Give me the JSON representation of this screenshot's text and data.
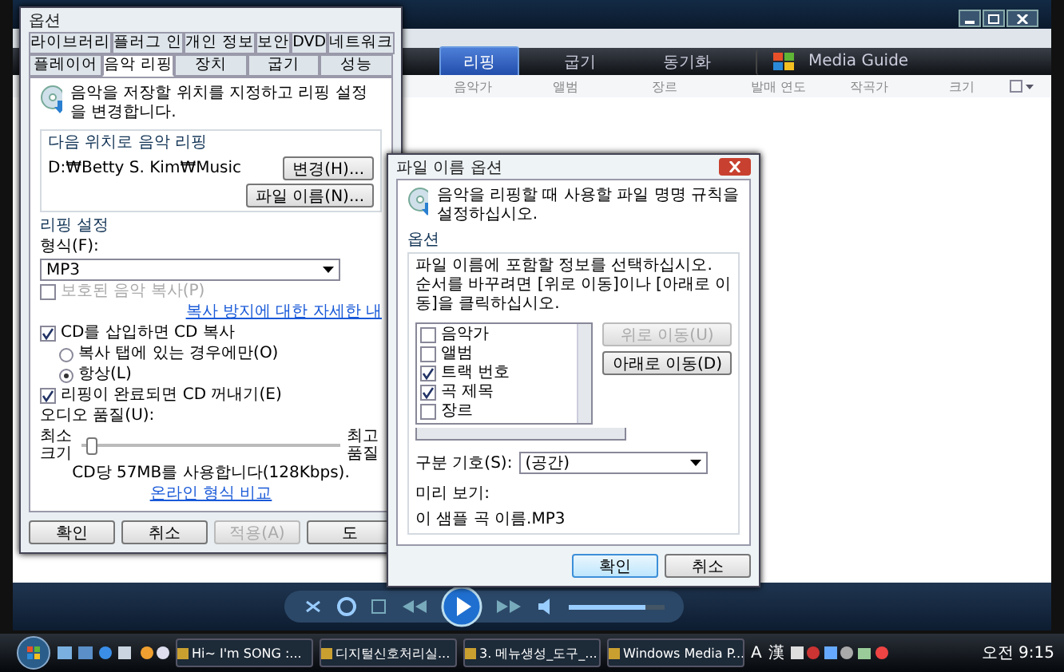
{
  "player": {
    "nav_tabs": [
      {
        "label": "리핑",
        "selected": true,
        "kind": "tab"
      },
      {
        "label": "굽기",
        "selected": false,
        "kind": "tab"
      },
      {
        "label": "동기화",
        "selected": false,
        "kind": "tab"
      },
      {
        "label": "Media Guide",
        "selected": false,
        "kind": "guide"
      }
    ],
    "columns": [
      "음악가",
      "앨범",
      "장르",
      "발매 연도",
      "작곡가",
      "크기"
    ],
    "volume": {
      "level": 0.8
    }
  },
  "options_dialog": {
    "title": "옵션",
    "tab_rows": [
      {
        "tabs": [
          {
            "label": "라이브러리",
            "selected": false
          },
          {
            "label": "플러그 인",
            "selected": false
          },
          {
            "label": "개인 정보",
            "selected": false
          },
          {
            "label": "보안",
            "selected": false
          },
          {
            "label": "DVD",
            "selected": false
          },
          {
            "label": "네트워크",
            "selected": false
          }
        ]
      },
      {
        "tabs": [
          {
            "label": "플레이어",
            "selected": false
          },
          {
            "label": "음악 리핑",
            "selected": true
          },
          {
            "label": "장치",
            "selected": false
          },
          {
            "label": "굽기",
            "selected": false
          },
          {
            "label": "성능",
            "selected": false
          }
        ]
      }
    ],
    "intro": "음악을 저장할 위치를 지정하고 리핑 설정을 변경합니다.",
    "location": {
      "label": "다음 위치로 음악 리핑",
      "path": "D:₩Betty S. Kim₩Music",
      "change_button": "변경(H)...",
      "filename_button": "파일 이름(N)..."
    },
    "settings_label": "리핑 설정",
    "format_label": "형식(F):",
    "format_value": "MP3",
    "items": [
      {
        "kind": "checkbox",
        "label": "보호된 음악 복사(P)",
        "checked": false,
        "disabled": true
      },
      {
        "kind": "link",
        "label": "복사 방지에 대한 자세한 내"
      },
      {
        "kind": "checkbox",
        "label": "CD를 삽입하면 CD 복사",
        "checked": true,
        "disabled": false
      },
      {
        "kind": "radio",
        "label": "복사 탭에 있는 경우에만(O)",
        "selected": false
      },
      {
        "kind": "radio",
        "label": "항상(L)",
        "selected": true
      },
      {
        "kind": "checkbox",
        "label": "리핑이 완료되면 CD 꺼내기(E)",
        "checked": true,
        "disabled": false
      }
    ],
    "quality": {
      "label": "오디오 품질(U):",
      "min_label": "최소 크기",
      "max_label": "최고 품질",
      "level": 0.02,
      "reading": "CD당 57MB를 사용합니다(128Kbps).",
      "link": "온라인 형식 비교"
    },
    "buttons": [
      {
        "label": "확인",
        "disabled": false
      },
      {
        "label": "취소",
        "disabled": false
      },
      {
        "label": "적용(A)",
        "disabled": true
      },
      {
        "label": "도",
        "disabled": false
      }
    ]
  },
  "filename_dialog": {
    "title": "파일 이름 옵션",
    "intro": "음악을 리핑할 때 사용할 파일 명명 규칙을 설정하십시오.",
    "group_label": "옵션",
    "instructions": "파일 이름에 포함할 정보를 선택하십시오. 순서를 바꾸려면 [위로 이동]이나 [아래로 이동]을 클릭하십시오.",
    "fields": [
      {
        "label": "음악가",
        "checked": false
      },
      {
        "label": "앨범",
        "checked": false
      },
      {
        "label": "트랙 번호",
        "checked": true
      },
      {
        "label": "곡 제목",
        "checked": true
      },
      {
        "label": "장르",
        "checked": false
      }
    ],
    "move_buttons": [
      {
        "label": "위로 이동(U)",
        "disabled": true
      },
      {
        "label": "아래로 이동(D)",
        "disabled": false
      }
    ],
    "separator": {
      "label": "구분 기호(S):",
      "value": "(공간)"
    },
    "preview": {
      "label": "미리 보기:",
      "value": "이 샘플 곡 이름.MP3"
    },
    "buttons": [
      {
        "label": "확인",
        "disabled": false
      },
      {
        "label": "취소",
        "disabled": false
      }
    ]
  },
  "taskbar": {
    "tasks": [
      "Hi~ I'm SONG :...",
      "디지털신호처리실...",
      "3. 메뉴생성_도구_...",
      "Windows Media P..."
    ],
    "language_bar": [
      "A",
      "漢"
    ],
    "clock": "오전 9:15"
  }
}
